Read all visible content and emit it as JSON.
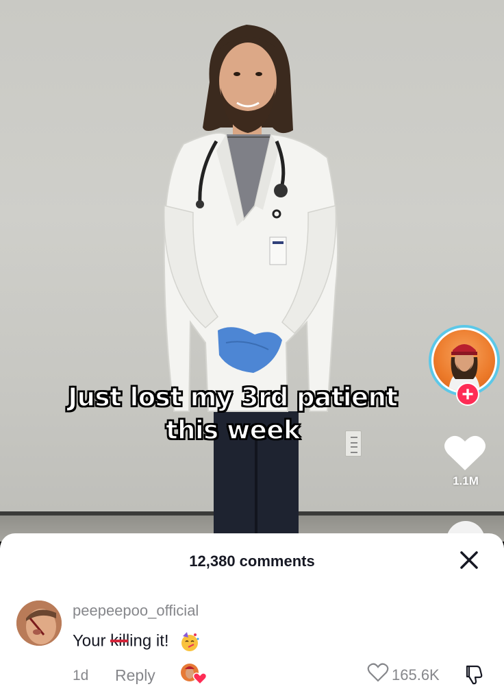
{
  "video": {
    "caption_lines": [
      "Just lost my 3rd patient",
      "this week"
    ]
  },
  "actions": {
    "follow_label": "+",
    "like_count": "1.1M",
    "more_label": "..."
  },
  "comments": {
    "count_label": "12,380 comments",
    "close_label": "×",
    "items": [
      {
        "username": "peepeepoo_official",
        "text_prefix": "Your ",
        "text_struck": "kill",
        "text_suffix": "ing it!",
        "emoji": "partying-face",
        "age": "1d",
        "reply_label": "Reply",
        "like_count": "165.6K"
      }
    ]
  },
  "colors": {
    "follow_red": "#fe2c55",
    "avatar_ring": "#5cc8e8",
    "strike_red": "#d3263a",
    "muted_text": "#86878b"
  }
}
